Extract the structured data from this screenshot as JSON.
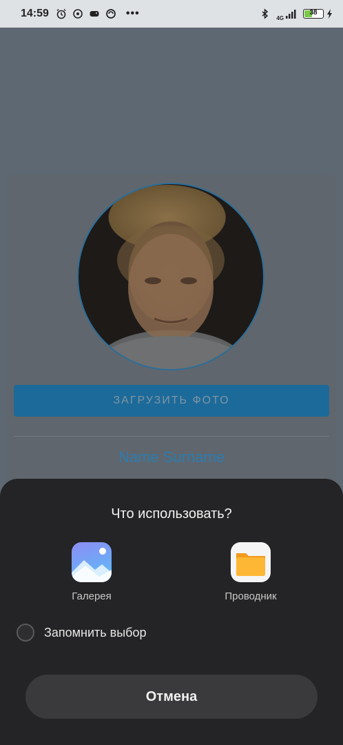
{
  "status_bar": {
    "time": "14:59",
    "left_icons": [
      "alarm-icon",
      "sync-icon",
      "game-icon",
      "vpn-icon"
    ],
    "more": "•••",
    "network": "4G",
    "battery_level": "38",
    "icons": [
      "bluetooth-icon",
      "signal-icon",
      "battery-icon",
      "charging-icon"
    ]
  },
  "profile": {
    "upload_label": "ЗАГРУЗИТЬ ФОТО",
    "name": "Name Surname"
  },
  "chooser": {
    "title": "Что использовать?",
    "options": [
      {
        "label": "Галерея",
        "icon": "gallery-icon"
      },
      {
        "label": "Проводник",
        "icon": "folder-icon"
      }
    ],
    "remember_label": "Запомнить выбор",
    "cancel_label": "Отмена"
  },
  "colors": {
    "accent": "#2b7cb0",
    "sheet_bg": "#242426",
    "button_bg": "#3a3a3c"
  }
}
